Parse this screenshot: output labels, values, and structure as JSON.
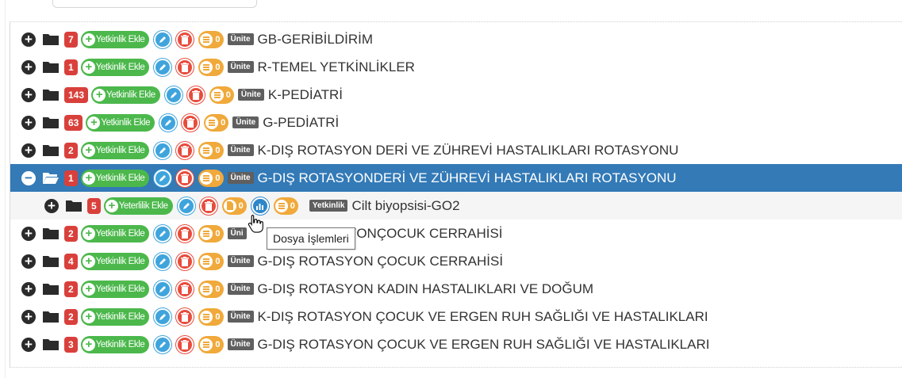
{
  "tree": {
    "rows": [
      {
        "count": "7",
        "add_label": "Yetkinlik Ekle",
        "files": "0",
        "type": "Ünite",
        "name": "GB-GERİBİLDİRİM"
      },
      {
        "count": "1",
        "add_label": "Yetkinlik Ekle",
        "files": "0",
        "type": "Ünite",
        "name": "R-TEMEL YETKİNLİKLER"
      },
      {
        "count": "143",
        "add_label": "Yetkinlik Ekle",
        "files": "0",
        "type": "Ünite",
        "name": "K-PEDİATRİ"
      },
      {
        "count": "63",
        "add_label": "Yetkinlik Ekle",
        "files": "0",
        "type": "Ünite",
        "name": "G-PEDİATRİ"
      },
      {
        "count": "2",
        "add_label": "Yetkinlik Ekle",
        "files": "0",
        "type": "Ünite",
        "name": "K-DIŞ ROTASYON DERİ VE ZÜHREVİ HASTALIKLARI ROTASYONU"
      },
      {
        "count": "1",
        "add_label": "Yetkinlik Ekle",
        "files": "0",
        "type": "Ünite",
        "name": "G-DIŞ ROTASYONDERİ VE ZÜHREVİ HASTALIKLARI ROTASYONU"
      },
      {
        "count": "2",
        "add_label": "Yetkinlik Ekle",
        "files": "0",
        "type": "Üni",
        "name": "SYONÇOCUK CERRAHİSİ"
      },
      {
        "count": "4",
        "add_label": "Yetkinlik Ekle",
        "files": "0",
        "type": "Ünite",
        "name": "G-DIŞ ROTASYON ÇOCUK CERRAHİSİ"
      },
      {
        "count": "2",
        "add_label": "Yetkinlik Ekle",
        "files": "0",
        "type": "Ünite",
        "name": "G-DIŞ ROTASYON KADIN HASTALIKLARI VE DOĞUM"
      },
      {
        "count": "2",
        "add_label": "Yetkinlik Ekle",
        "files": "0",
        "type": "Ünite",
        "name": "K-DIŞ ROTASYON ÇOCUK VE ERGEN RUH SAĞLIĞI VE HASTALIKLARI"
      },
      {
        "count": "3",
        "add_label": "Yetkinlik Ekle",
        "files": "0",
        "type": "Ünite",
        "name": "G-DIŞ ROTASYON ÇOCUK VE ERGEN RUH SAĞLIĞI VE HASTALIKLARI"
      }
    ],
    "child": {
      "count": "5",
      "add_label": "Yeterlilik Ekle",
      "doc_count": "0",
      "files": "0",
      "type": "Yetkinlik",
      "name": "Cilt biyopsisi-GO2"
    }
  },
  "tooltip": {
    "text": "Dosya İşlemleri"
  },
  "toggle": {
    "collapsed": "+",
    "expanded": "−"
  },
  "colors": {
    "selected": "#337ab7",
    "count_badge": "#d9403b",
    "add_button": "#4cb84c",
    "edit": "#3fa4dc",
    "delete": "#e84c3d",
    "files_pill": "#f0a93b",
    "type_tag": "#5f5f5f"
  }
}
